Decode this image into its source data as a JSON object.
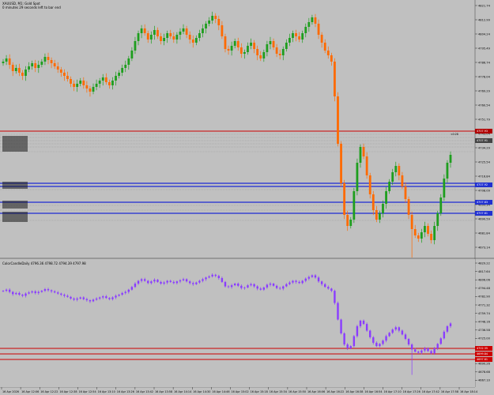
{
  "main_panel": {
    "symbol_line": "XAUUSD, M1: Gold Spot",
    "timer_line": "0 minutes 29 seconds left to bar end",
    "countdown": "<0:28",
    "price_scale": [
      "4821.74",
      "4812.99",
      "4804.24",
      "4795.49",
      "4786.74",
      "4778.04",
      "4769.29",
      "4760.54",
      "4751.79",
      "4743.04",
      "4734.29",
      "4725.54",
      "4716.84",
      "4708.09",
      "4699.34",
      "4690.59",
      "4681.84",
      "4673.14"
    ],
    "tags": [
      {
        "text": "4707.93",
        "color": "#b00000"
      },
      {
        "text": "4707.91",
        "color": "#444444"
      },
      {
        "text": "4707.92",
        "color": "#2030d0"
      },
      {
        "text": "4707.83",
        "color": "#2030d0"
      },
      {
        "text": "4707.81",
        "color": "#2030d0"
      }
    ]
  },
  "indicator_panel": {
    "header": "ColorCandleDaily  4796.36  4798.72  4794.39  4797.98",
    "scale": [
      "4829.22",
      "4817.64",
      "4806.06",
      "4794.48",
      "4782.90",
      "4771.32",
      "4759.74",
      "4748.16",
      "4736.58",
      "4725.00",
      "4713.42",
      "4701.84",
      "4690.26",
      "4678.68",
      "4667.10"
    ],
    "tags": [
      "4702.35",
      "4699.84",
      "4697.61"
    ]
  },
  "time_axis": [
    "16 Apr 2026",
    "16 Apr 12:06",
    "16 Apr 12:22",
    "16 Apr 12:38",
    "16 Apr 12:54",
    "16 Apr 13:10",
    "16 Apr 13:26",
    "16 Apr 13:42",
    "16 Apr 13:58",
    "16 Apr 14:14",
    "16 Apr 14:30",
    "16 Apr 14:46",
    "16 Apr 15:02",
    "16 Apr 15:18",
    "16 Apr 15:34",
    "16 Apr 15:50",
    "16 Apr 16:06",
    "16 Apr 16:22",
    "16 Apr 16:38",
    "16 Apr 16:54",
    "16 Apr 17:10",
    "16 Apr 17:26",
    "16 Apr 17:42",
    "16 Apr 17:58",
    "16 Apr 18:14"
  ],
  "chart_data": {
    "type": "candlestick",
    "closes": [
      4772,
      4774,
      4770,
      4766,
      4768,
      4765,
      4763,
      4767,
      4769,
      4771,
      4768,
      4770,
      4772,
      4775,
      4773,
      4771,
      4769,
      4767,
      4765,
      4763,
      4761,
      4758,
      4756,
      4758,
      4760,
      4757,
      4755,
      4753,
      4756,
      4758,
      4760,
      4762,
      4759,
      4757,
      4760,
      4763,
      4765,
      4768,
      4770,
      4774,
      4779,
      4785,
      4790,
      4793,
      4790,
      4786,
      4789,
      4792,
      4788,
      4785,
      4787,
      4790,
      4788,
      4786,
      4789,
      4791,
      4793,
      4789,
      4786,
      4784,
      4787,
      4790,
      4793,
      4796,
      4798,
      4801,
      4799,
      4795,
      4788,
      4780,
      4779,
      4782,
      4785,
      4781,
      4777,
      4778,
      4782,
      4784,
      4780,
      4776,
      4774,
      4778,
      4783,
      4785,
      4781,
      4777,
      4776,
      4780,
      4784,
      4787,
      4790,
      4788,
      4786,
      4790,
      4794,
      4797,
      4800,
      4796,
      4789,
      4784,
      4779,
      4776,
      4772,
      4750,
      4720,
      4695,
      4675,
      4668,
      4672,
      4690,
      4708,
      4718,
      4712,
      4700,
      4688,
      4678,
      4672,
      4676,
      4682,
      4690,
      4696,
      4702,
      4706,
      4700,
      4693,
      4685,
      4675,
      4666,
      4662,
      4660,
      4664,
      4668,
      4663,
      4659,
      4668,
      4676,
      4686,
      4698,
      4708,
      4713
    ]
  },
  "colors": {
    "bull": "#1e9e1e",
    "bear": "#ff6a00",
    "violet": "#8a3cff",
    "level_red": "#cc0000",
    "level_blue": "#1c2bd4"
  }
}
